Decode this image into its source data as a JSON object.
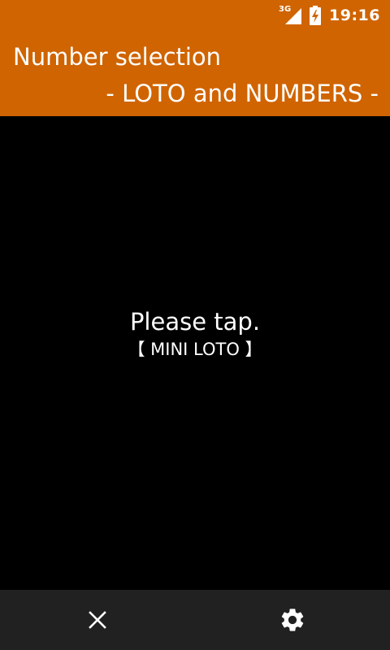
{
  "status_bar": {
    "network_type": "3G",
    "time": "19:16",
    "icons": [
      "signal-icon",
      "battery-charging-icon"
    ]
  },
  "header": {
    "title": "Number selection",
    "subtitle": "- LOTO and NUMBERS -",
    "background_color": "#d06400"
  },
  "main": {
    "prompt": "Please tap.",
    "game_name": "【 MINI LOTO 】"
  },
  "bottom_bar": {
    "buttons": [
      {
        "icon": "close-icon"
      },
      {
        "icon": "gear-icon"
      }
    ],
    "background_color": "#212121"
  }
}
